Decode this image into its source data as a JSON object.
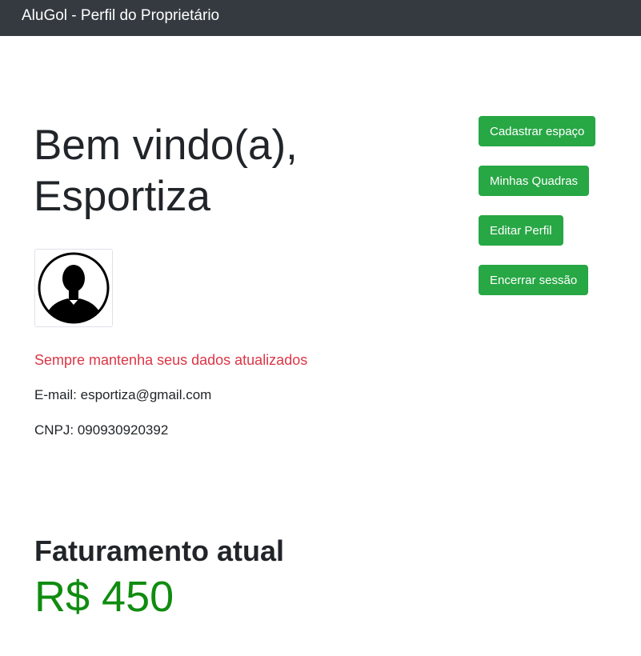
{
  "navbar": {
    "brand": "AluGol - Perfil do Proprietário"
  },
  "profile": {
    "welcome_line1": "Bem vindo(a),",
    "welcome_line2": "Esportiza",
    "avatar_icon": "user-silhouette-icon",
    "notice": "Sempre mantenha seus dados atualizados",
    "email": "E-mail: esportiza@gmail.com",
    "cnpj": "CNPJ: 090930920392"
  },
  "actions": {
    "register_space": "Cadastrar espaço",
    "my_courts": "Minhas Quadras",
    "edit_profile": "Editar Perfil",
    "logout": "Encerrar sessão"
  },
  "revenue": {
    "title": "Faturamento atual",
    "value": "R$ 450"
  },
  "colors": {
    "navbar": "#343a40",
    "button": "#28a745",
    "notice": "#dc3545",
    "revenue": "#108c10"
  }
}
